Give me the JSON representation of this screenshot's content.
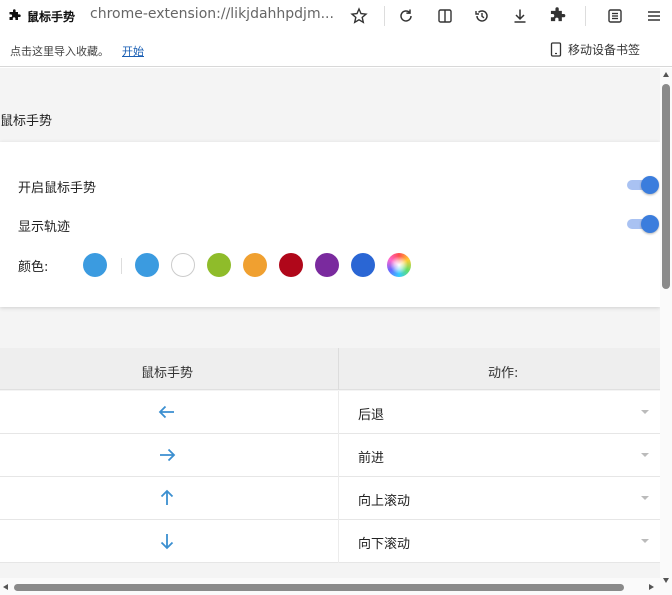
{
  "tab": {
    "icon": "puzzle-icon",
    "title": "鼠标手势"
  },
  "url": "chrome-extension://likjdahhpdjm...",
  "toolbar_icons": [
    "star-icon",
    "reload-icon",
    "split-icon",
    "history-icon",
    "download-icon",
    "extensions-icon",
    "reader-icon",
    "menu-icon"
  ],
  "bookmarks": {
    "prompt": "点击这里导入收藏。",
    "start_link": "开始",
    "mobile": "移动设备书签"
  },
  "section": {
    "title": "鼠标手势"
  },
  "settings": {
    "enable_label": "开启鼠标手势",
    "enable_on": true,
    "trail_label": "显示轨迹",
    "trail_on": true,
    "color_label": "颜色:",
    "current_color": "#3b9be0",
    "palette": [
      "#3b9be0",
      "#ffffff",
      "#8fbc2a",
      "#f0a030",
      "#b0071a",
      "#7a2a9e",
      "#2a66d4",
      "rainbow"
    ]
  },
  "table": {
    "col_gesture": "鼠标手势",
    "col_action": "动作:",
    "rows": [
      {
        "gesture": "left-arrow-icon",
        "action": "后退"
      },
      {
        "gesture": "right-arrow-icon",
        "action": "前进"
      },
      {
        "gesture": "up-arrow-icon",
        "action": "向上滚动"
      },
      {
        "gesture": "down-arrow-icon",
        "action": "向下滚动"
      }
    ]
  },
  "colors": {
    "accent": "#3b7ddd",
    "arrow": "#3b8fd0"
  }
}
